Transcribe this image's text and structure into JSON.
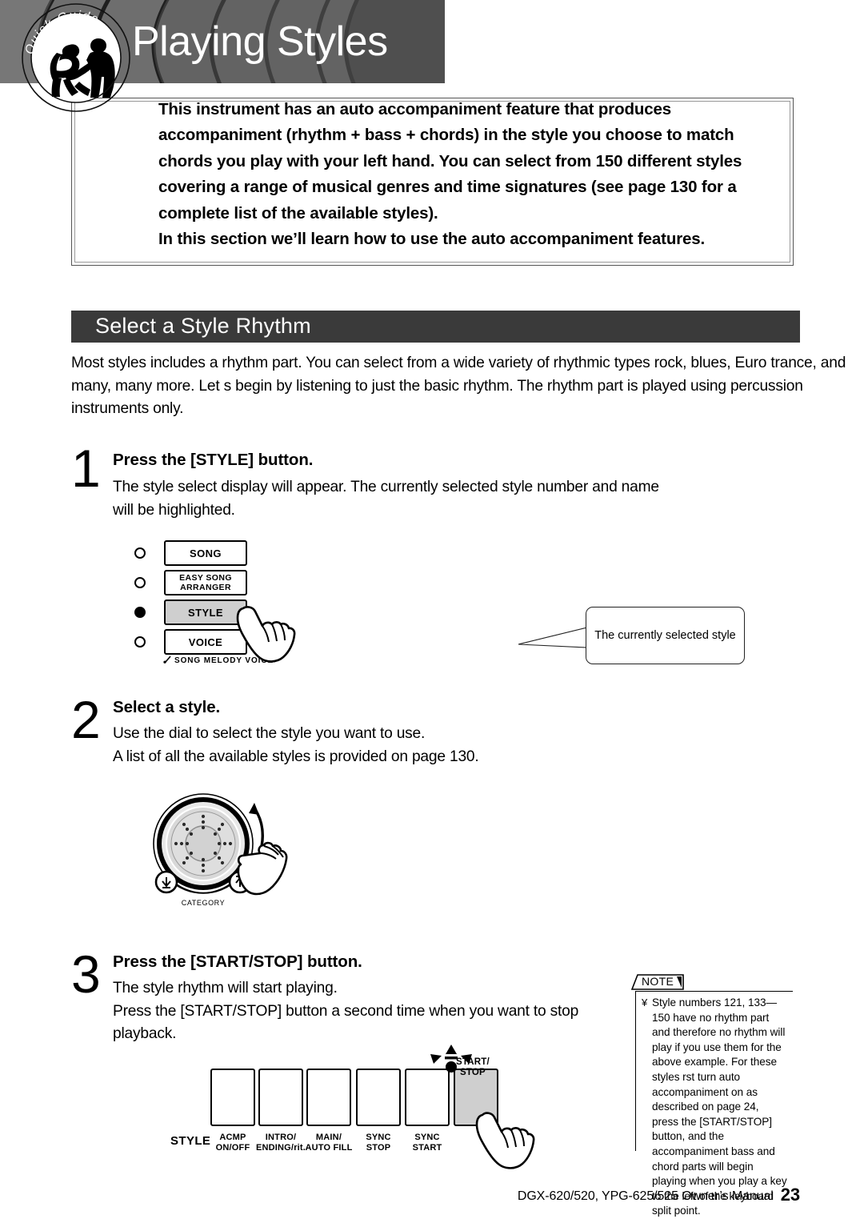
{
  "header": {
    "badge_text": "Quick Guide",
    "title": "Playing Styles",
    "logo_name": "quick-guide-dancers-logo"
  },
  "intro": {
    "lines": [
      "This instrument has an auto accompaniment feature that produces accompaniment (rhythm + bass + chords) in the style you choose to match chords you play with your left hand. You can select from 150 different styles covering a range of musical genres and time signatures (see page 130 for a complete list of the available styles).",
      "In this section we’ll learn how to use the auto accompaniment features."
    ]
  },
  "section": {
    "heading": "Select a Style Rhythm",
    "paragraph": "Most styles includes a rhythm part. You can select from a wide variety of rhythmic types rock, blues, Euro trance, and many, many more. Let s begin by listening to just the basic rhythm. The rhythm part is played using percussion instruments only."
  },
  "steps": [
    {
      "number": "1",
      "heading": "Press the [STYLE] button.",
      "body": "The style select display will appear. The currently selected style number and name will be highlighted."
    },
    {
      "number": "2",
      "heading": "Select a style.",
      "body_lines": [
        "Use the dial to select the style you want to use.",
        "A list of all the available styles is provided on page 130."
      ]
    },
    {
      "number": "3",
      "heading": "Press the [START/STOP] button.",
      "body_lines": [
        "The style rhythm will start playing.",
        "Press the [START/STOP] button a second time when you want to stop",
        "playback."
      ]
    }
  ],
  "panel_mode": {
    "buttons": [
      {
        "label": "SONG",
        "led": "off"
      },
      {
        "label": "EASY SONG\nARRANGER",
        "led": "off"
      },
      {
        "label": "STYLE",
        "led": "on",
        "selected": true
      },
      {
        "label": "VOICE",
        "led": "off"
      }
    ],
    "footnote": "SONG MELODY VOICE",
    "hand_icon": "pointing-hand-icon"
  },
  "callout": {
    "text": "The currently selected style"
  },
  "dial": {
    "category_label": "CATEGORY",
    "down_button": "category-down-button",
    "up_button": "category-up-button",
    "rotate_arrow": "rotate-arrow-icon",
    "hand_icon": "pointing-hand-icon"
  },
  "note": {
    "title": "NOTE",
    "bullet": "¥",
    "text": "Style numbers 121, 133—150 have no rhythm part and therefore no rhythm will play if you use them for the above example. For these styles  rst turn auto accompaniment on as described on page 24, press the [START/STOP] button, and the accompaniment bass and chord parts will begin playing when you play a key to the left of the keyboard split point."
  },
  "panel_style": {
    "group_label": "STYLE",
    "buttons": [
      {
        "label": "ACMP\nON/OFF",
        "selected": false
      },
      {
        "label": "INTRO/\nENDING/rit.",
        "selected": false
      },
      {
        "label": "MAIN/\nAUTO FILL",
        "selected": false
      },
      {
        "label": "SYNC\nSTOP",
        "selected": false
      },
      {
        "label": "SYNC\nSTART",
        "selected": false
      },
      {
        "label": "START/\nSTOP",
        "selected": true
      }
    ],
    "led_state": "blinking",
    "hand_icon": "pointing-hand-icon"
  },
  "footer": {
    "manual": "DGX-620/520, YPG-625/525  Owner’s Manual",
    "page": "23"
  },
  "colors": {
    "banner_gray": "#6e6e6e",
    "section_bar": "#3a3a3a",
    "selected_button": "#cfcfcf"
  }
}
